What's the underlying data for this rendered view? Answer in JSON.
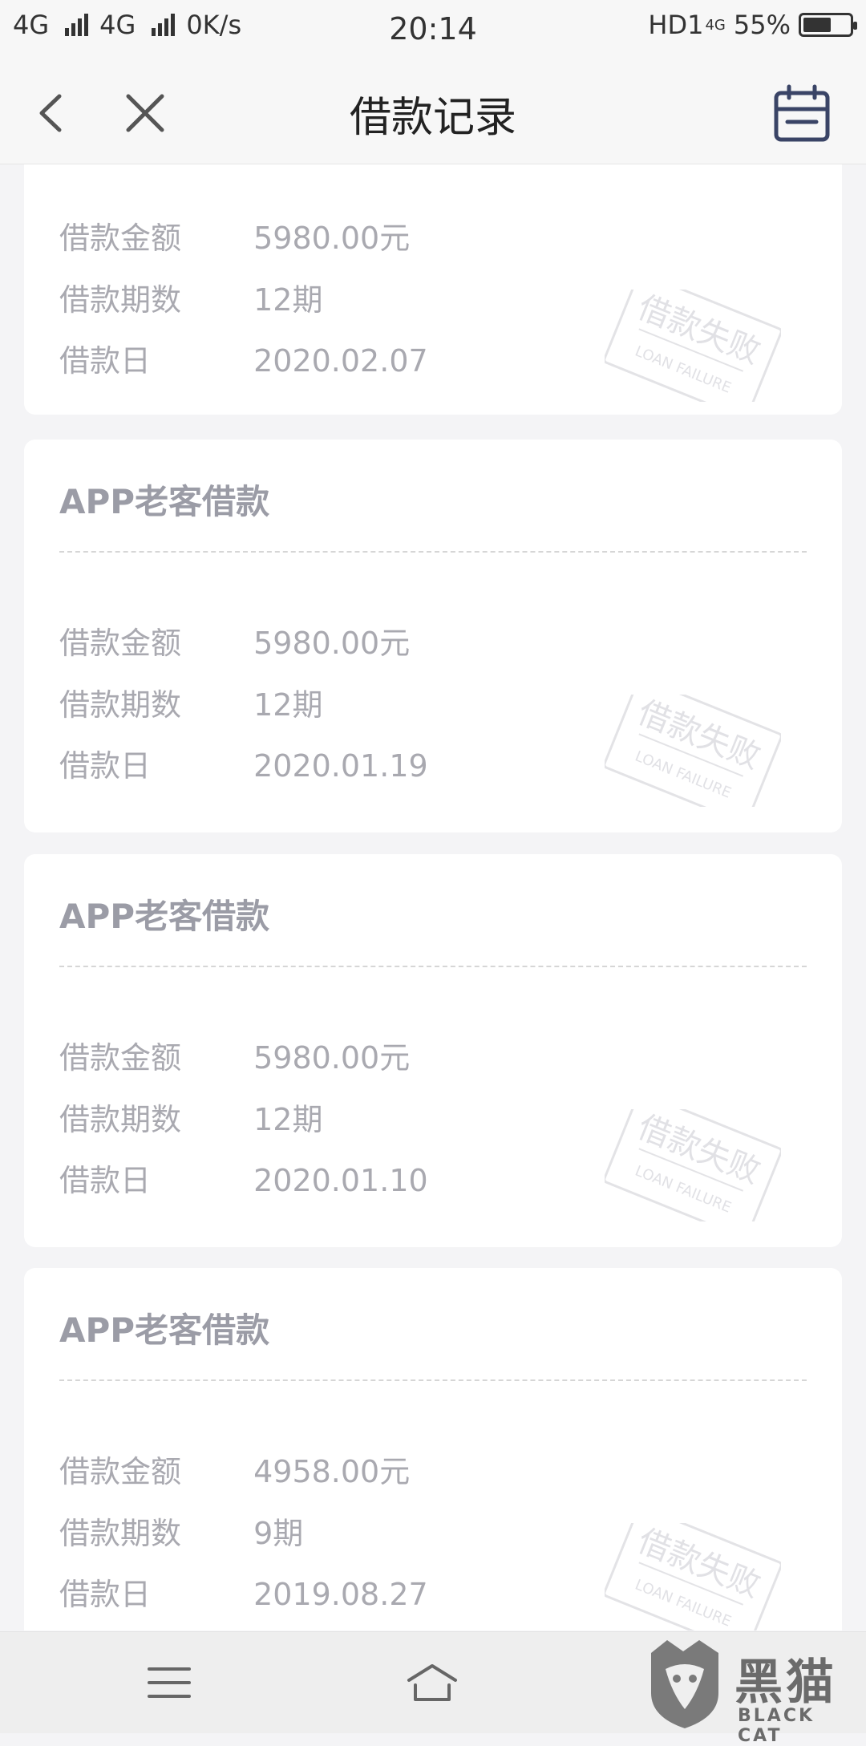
{
  "status_bar": {
    "network1": "4G",
    "network2": "4G",
    "speed": "0K/s",
    "time": "20:14",
    "hd": "HD1",
    "hd_sub": "4G",
    "battery": "55%"
  },
  "header": {
    "title": "借款记录"
  },
  "cards": [
    {
      "title": "",
      "amount_label": "借款金额",
      "amount": "5980.00元",
      "periods_label": "借款期数",
      "periods": "12期",
      "date_label": "借款日",
      "date": "2020.02.07",
      "stamp": "借款失败",
      "stamp_en": "LOAN FAILURE"
    },
    {
      "title": "APP老客借款",
      "amount_label": "借款金额",
      "amount": "5980.00元",
      "periods_label": "借款期数",
      "periods": "12期",
      "date_label": "借款日",
      "date": "2020.01.19",
      "stamp": "借款失败",
      "stamp_en": "LOAN FAILURE"
    },
    {
      "title": "APP老客借款",
      "amount_label": "借款金额",
      "amount": "5980.00元",
      "periods_label": "借款期数",
      "periods": "12期",
      "date_label": "借款日",
      "date": "2020.01.10",
      "stamp": "借款失败",
      "stamp_en": "LOAN FAILURE"
    },
    {
      "title": "APP老客借款",
      "amount_label": "借款金额",
      "amount": "4958.00元",
      "periods_label": "借款期数",
      "periods": "9期",
      "date_label": "借款日",
      "date": "2019.08.27",
      "stamp": "借款失败",
      "stamp_en": "LOAN FAILURE"
    }
  ],
  "watermark": {
    "cn": "黑猫",
    "en": "BLACK CAT"
  },
  "colors": {
    "background": "#f4f4f6",
    "card_title": "#9b9ca6",
    "row_text": "#a9a9b0",
    "accent_icon": "#3a4466"
  }
}
